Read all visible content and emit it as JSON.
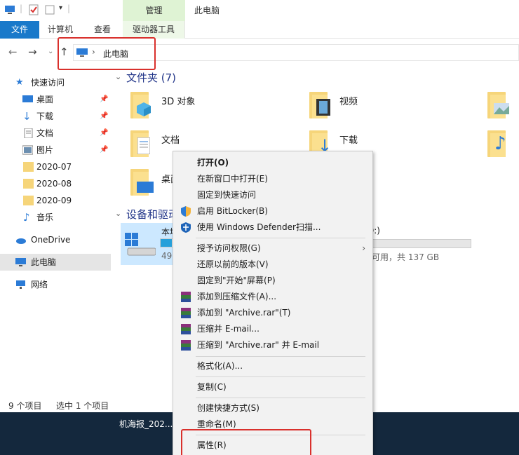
{
  "window": {
    "title": "此电脑",
    "contextual_tab": "管理"
  },
  "ribbon": {
    "tabs": [
      "文件",
      "计算机",
      "查看",
      "驱动器工具"
    ]
  },
  "address": {
    "path": "此电脑"
  },
  "sidebar": {
    "quick_access": "快速访问",
    "items": [
      {
        "label": "桌面",
        "icon": "desktop-icon",
        "pinned": true
      },
      {
        "label": "下载",
        "icon": "download-icon",
        "pinned": true
      },
      {
        "label": "文档",
        "icon": "document-icon",
        "pinned": true
      },
      {
        "label": "图片",
        "icon": "picture-icon",
        "pinned": true
      },
      {
        "label": "2020-07",
        "icon": "folder-icon",
        "pinned": false
      },
      {
        "label": "2020-08",
        "icon": "folder-icon",
        "pinned": false
      },
      {
        "label": "2020-09",
        "icon": "folder-icon",
        "pinned": false
      },
      {
        "label": "音乐",
        "icon": "music-icon",
        "pinned": false
      }
    ],
    "onedrive": "OneDrive",
    "this_pc": "此电脑",
    "network": "网络"
  },
  "main": {
    "folders_group": "文件夹 (7)",
    "folders": [
      {
        "name": "3D 对象",
        "overlay": "3d-cube-icon"
      },
      {
        "name": "视频",
        "overlay": "film-icon"
      },
      {
        "name": "",
        "overlay": "landscape-icon"
      },
      {
        "name": "文档",
        "overlay": "document-icon"
      },
      {
        "name": "下载",
        "overlay": "download-arrow-icon"
      },
      {
        "name": "",
        "overlay": "music-note-icon"
      },
      {
        "name": "桌面",
        "overlay": "desktop-icon"
      }
    ],
    "devices_group": "设备和驱动",
    "drive": {
      "name": "本地",
      "free": "49.",
      "used_fraction": 0.64
    },
    "drive2": {
      "name": "D:)",
      "free": "可用，共 137 GB",
      "used_fraction": 0.0
    }
  },
  "status": {
    "count": "9 个项目",
    "selected": "选中 1 个项目"
  },
  "taskbar": {
    "item": "机海报_202..."
  },
  "context_menu": {
    "items": [
      {
        "label": "打开(O)",
        "bold": true
      },
      {
        "label": "在新窗口中打开(E)"
      },
      {
        "label": "固定到快速访问"
      },
      {
        "label": "启用 BitLocker(B)",
        "icon": "shield-icon"
      },
      {
        "label": "使用 Windows Defender扫描...",
        "icon": "defender-icon"
      },
      {
        "label": "授予访问权限(G)",
        "submenu": true
      },
      {
        "label": "还原以前的版本(V)"
      },
      {
        "label": "固定到\"开始\"屏幕(P)"
      },
      {
        "label": "添加到压缩文件(A)...",
        "icon": "winrar-icon"
      },
      {
        "label": "添加到 \"Archive.rar\"(T)",
        "icon": "winrar-icon"
      },
      {
        "label": "压缩并 E-mail...",
        "icon": "winrar-icon"
      },
      {
        "label": "压缩到 \"Archive.rar\" 并 E-mail",
        "icon": "winrar-icon"
      },
      {
        "label": "格式化(A)..."
      },
      {
        "label": "复制(C)"
      },
      {
        "label": "创建快捷方式(S)"
      },
      {
        "label": "重命名(M)"
      },
      {
        "label": "属性(R)"
      }
    ]
  },
  "colors": {
    "accent": "#1979ca",
    "highlight": "#d9302c",
    "folder": "#f6d57a",
    "taskbar": "#14283d"
  }
}
